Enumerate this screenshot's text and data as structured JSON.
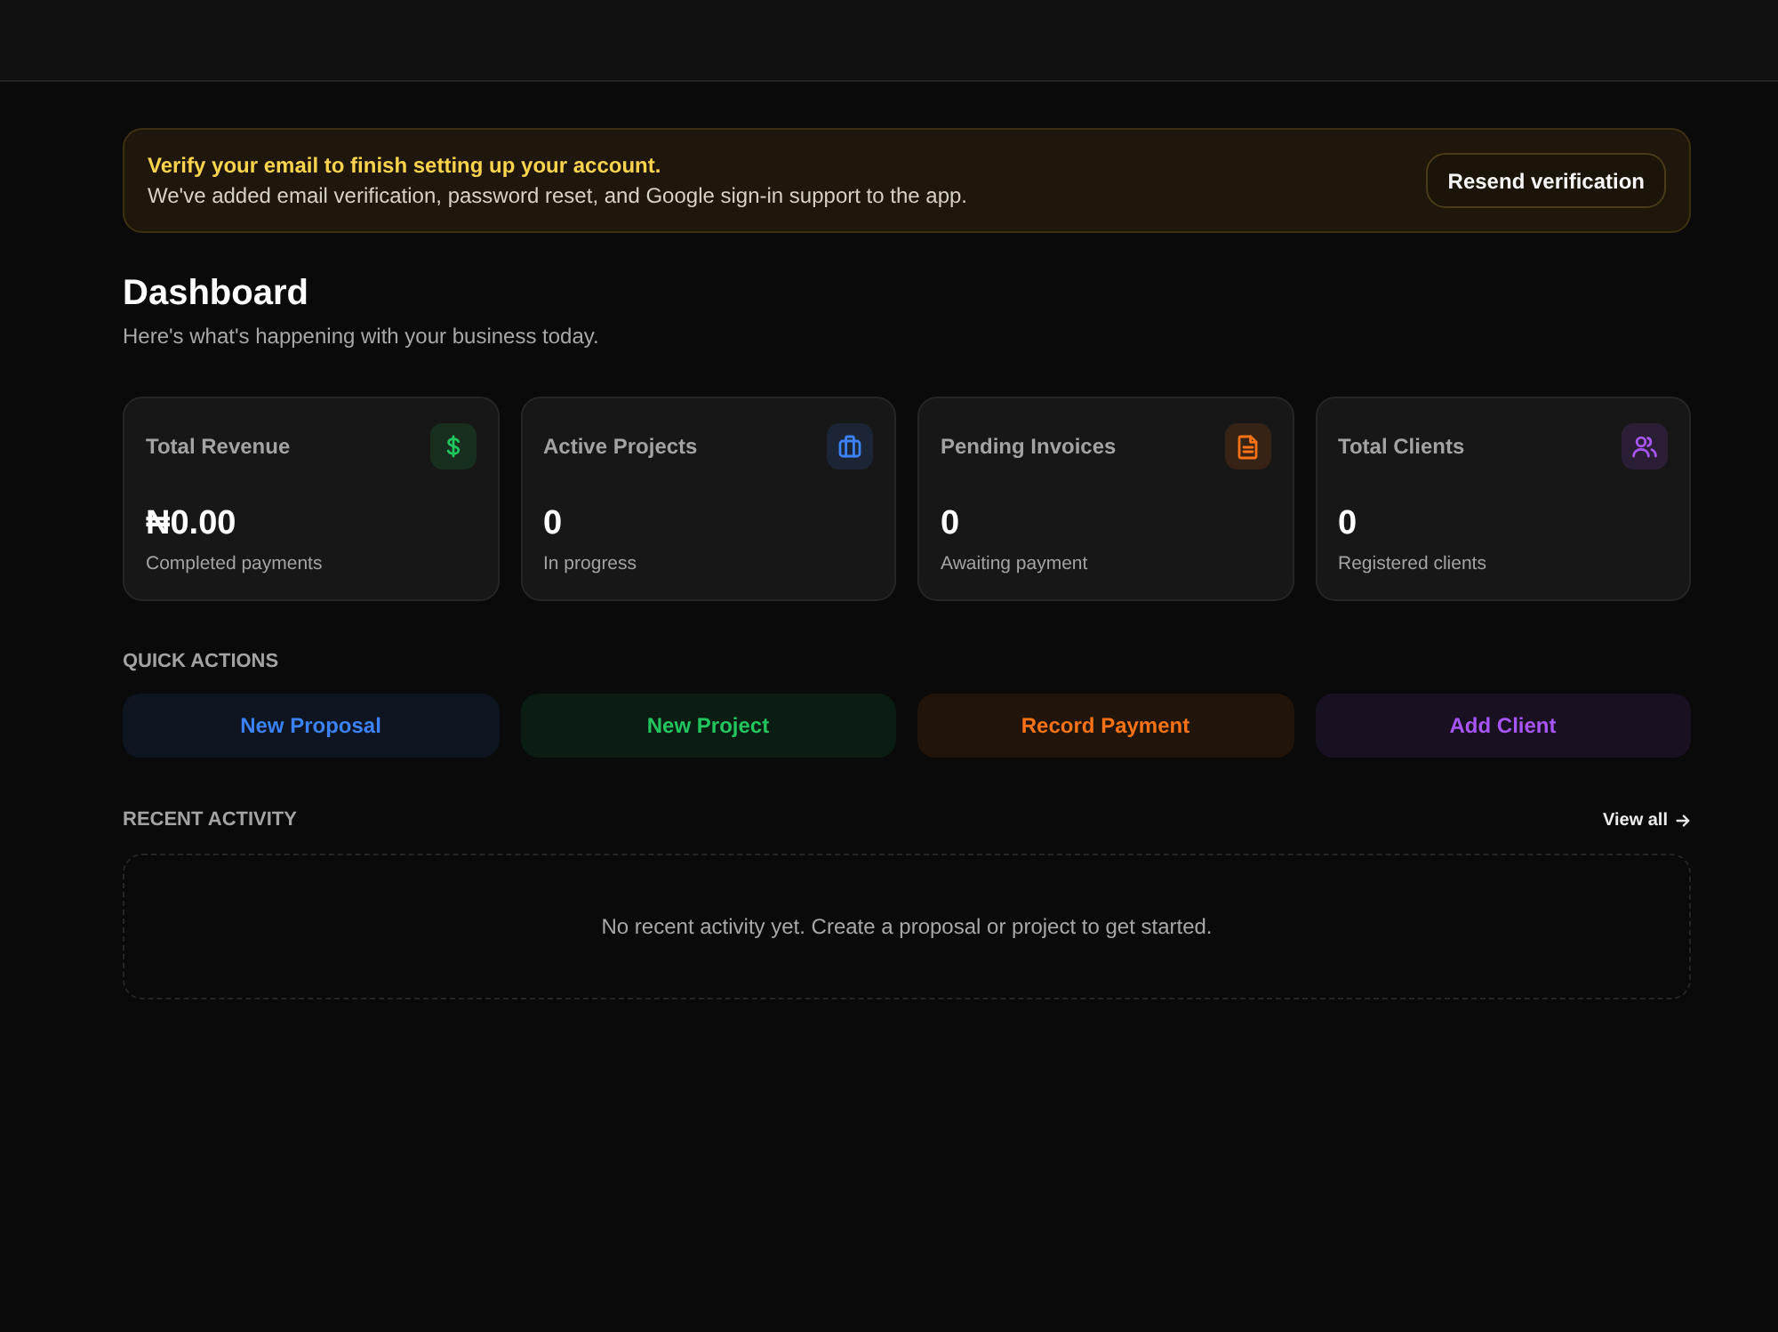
{
  "banner": {
    "title": "Verify your email to finish setting up your account.",
    "message": "We've added email verification, password reset, and Google sign-in support to the app.",
    "button": "Resend verification"
  },
  "header": {
    "title": "Dashboard",
    "subtitle": "Here's what's happening with your business today."
  },
  "stats": [
    {
      "label": "Total Revenue",
      "value": "₦0.00",
      "caption": "Completed payments",
      "color": "#22c55e"
    },
    {
      "label": "Active Projects",
      "value": "0",
      "caption": "In progress",
      "color": "#3b82f6"
    },
    {
      "label": "Pending Invoices",
      "value": "0",
      "caption": "Awaiting payment",
      "color": "#f97316"
    },
    {
      "label": "Total Clients",
      "value": "0",
      "caption": "Registered clients",
      "color": "#a855f7"
    }
  ],
  "quick_actions": {
    "title": "QUICK ACTIONS",
    "buttons": [
      {
        "label": "New Proposal",
        "color": "#3b82f6"
      },
      {
        "label": "New Project",
        "color": "#22c55e"
      },
      {
        "label": "Record Payment",
        "color": "#f97316"
      },
      {
        "label": "Add Client",
        "color": "#a855f7"
      }
    ]
  },
  "recent_activity": {
    "title": "RECENT ACTIVITY",
    "link": "View all",
    "empty_message": "No recent activity yet. Create a proposal or project to get started."
  }
}
